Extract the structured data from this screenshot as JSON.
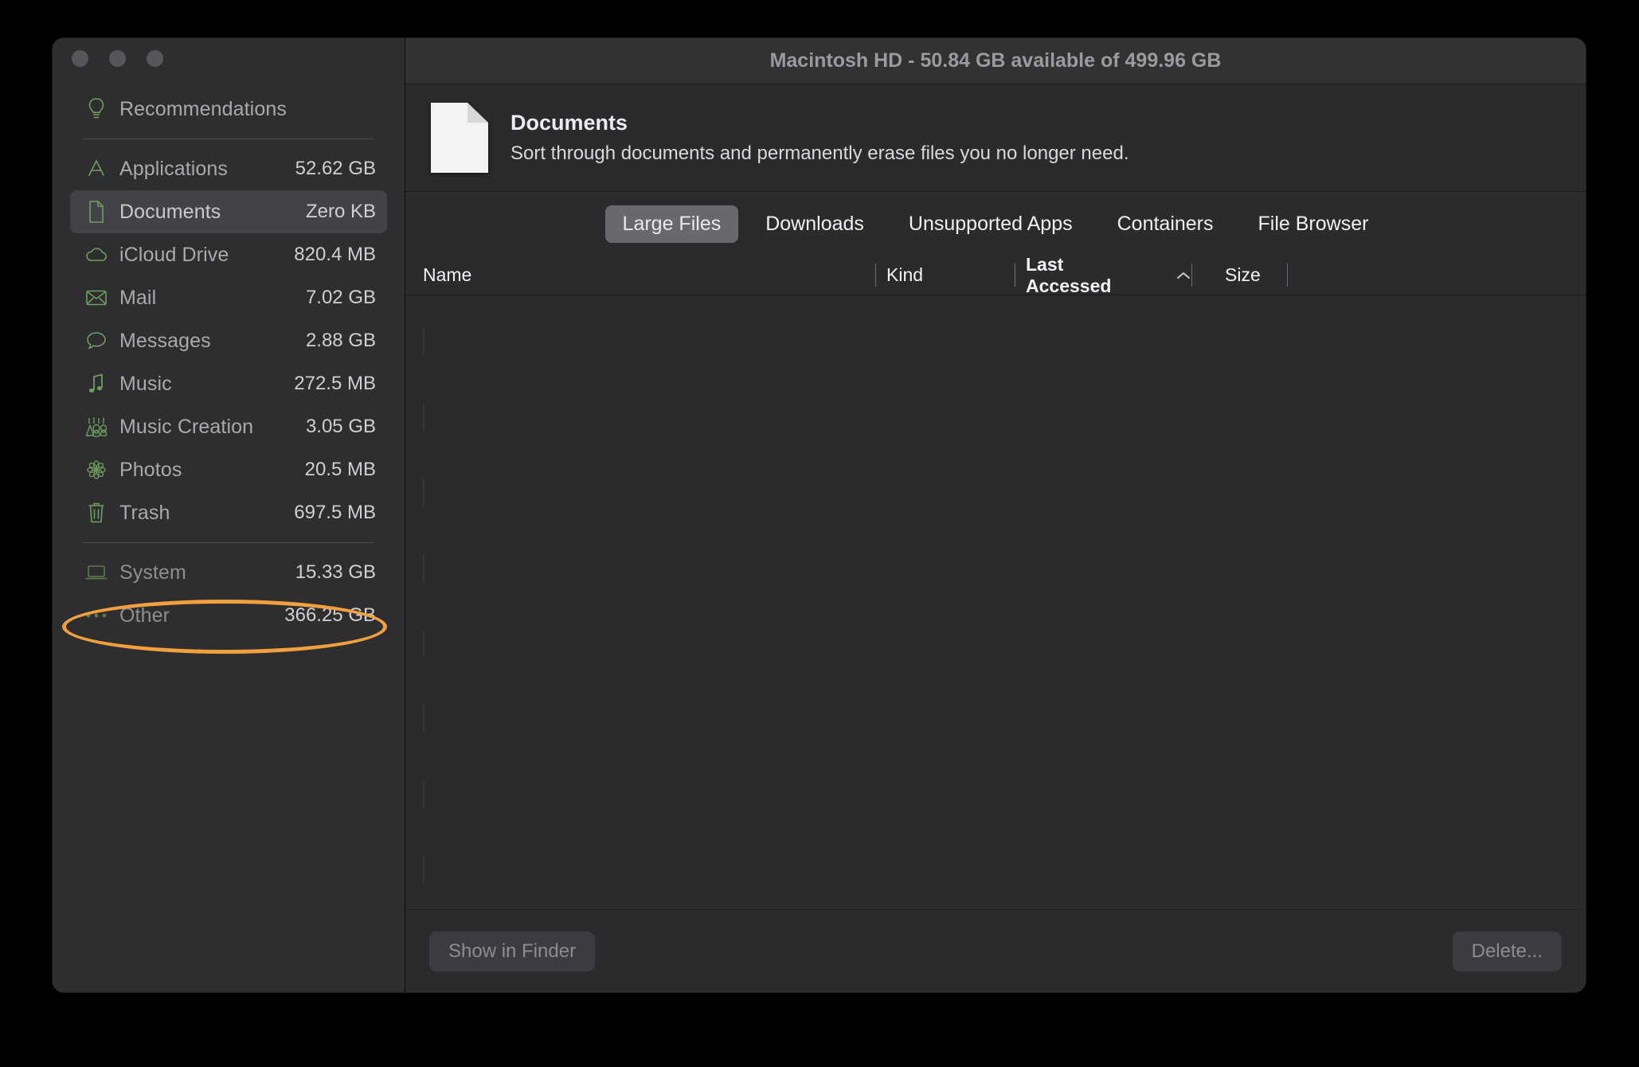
{
  "window": {
    "title": "Macintosh HD - 50.84 GB available of 499.96 GB"
  },
  "sidebar": {
    "items": [
      {
        "icon": "lightbulb-icon",
        "label": "Recommendations",
        "size": ""
      },
      {
        "icon": "app-store-icon",
        "label": "Applications",
        "size": "52.62 GB"
      },
      {
        "icon": "document-icon",
        "label": "Documents",
        "size": "Zero KB"
      },
      {
        "icon": "cloud-icon",
        "label": "iCloud Drive",
        "size": "820.4 MB"
      },
      {
        "icon": "envelope-icon",
        "label": "Mail",
        "size": "7.02 GB"
      },
      {
        "icon": "speech-bubble-icon",
        "label": "Messages",
        "size": "2.88 GB"
      },
      {
        "icon": "music-note-icon",
        "label": "Music",
        "size": "272.5 MB"
      },
      {
        "icon": "guitar-icon",
        "label": "Music Creation",
        "size": "3.05 GB"
      },
      {
        "icon": "photos-flower-icon",
        "label": "Photos",
        "size": "20.5 MB"
      },
      {
        "icon": "trash-icon",
        "label": "Trash",
        "size": "697.5 MB"
      },
      {
        "icon": "laptop-icon",
        "label": "System",
        "size": "15.33 GB"
      },
      {
        "icon": "ellipsis-icon",
        "label": "Other",
        "size": "366.25 GB"
      }
    ],
    "selected": "Documents",
    "annotation": {
      "target": "Other",
      "color": "#f2a03d",
      "shape": "ellipse"
    }
  },
  "category": {
    "icon": "document-page-icon",
    "title": "Documents",
    "subtitle": "Sort through documents and permanently erase files you no longer need."
  },
  "tabs": [
    {
      "label": "Large Files",
      "active": true
    },
    {
      "label": "Downloads",
      "active": false
    },
    {
      "label": "Unsupported Apps",
      "active": false
    },
    {
      "label": "Containers",
      "active": false
    },
    {
      "label": "File Browser",
      "active": false
    }
  ],
  "table": {
    "columns": [
      {
        "label": "Name",
        "sorted": false
      },
      {
        "label": "Kind",
        "sorted": false
      },
      {
        "label": "Last Accessed",
        "sorted": true,
        "sort_direction": "ascending"
      },
      {
        "label": "Size",
        "sorted": false
      }
    ],
    "rows": []
  },
  "footer": {
    "show_in_finder_label": "Show in Finder",
    "delete_label": "Delete..."
  }
}
